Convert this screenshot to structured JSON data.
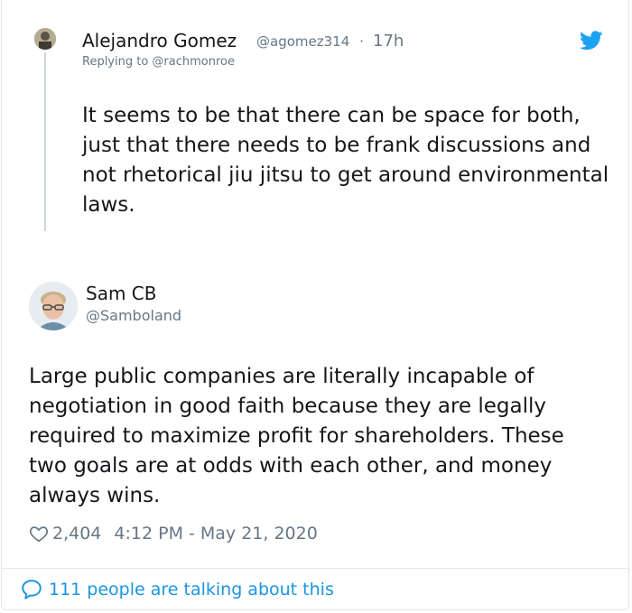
{
  "reply": {
    "name": "Alejandro Gomez",
    "handle": "@agomez314",
    "separator": "·",
    "time": "17h",
    "replying_to": "Replying to @rachmonroe",
    "text": "It seems to be that there can be space for both, just that there needs to be frank discussions and not rhetorical jiu jitsu to get around environmental laws."
  },
  "tweet": {
    "name": "Sam CB",
    "handle": "@Samboland",
    "text": "Large public companies are literally incapable of negotiation in good faith because they are legally required to maximize profit for shareholders. These two goals are at odds with each other, and money always wins.",
    "likes": "2,404",
    "timestamp": "4:12 PM - May 21, 2020"
  },
  "footer": {
    "talking": "111 people are talking about this"
  },
  "icons": {
    "brand": "twitter-bird-icon",
    "like": "heart-icon",
    "conversation": "speech-bubble-icon"
  },
  "colors": {
    "brand_blue": "#1da1f2",
    "link_blue": "#1b95e0",
    "muted": "#657786",
    "text": "#14171a"
  }
}
